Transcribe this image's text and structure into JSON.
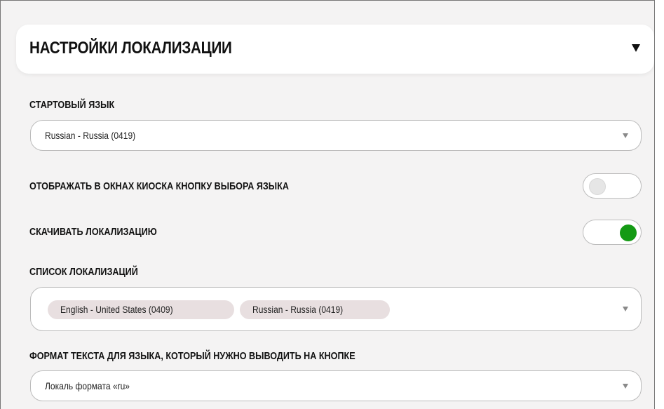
{
  "section": {
    "title": "НАСТРОЙКИ ЛОКАЛИЗАЦИИ",
    "collapse_icon": "caret-down-icon"
  },
  "start_language": {
    "label": "СТАРТОВЫЙ ЯЗЫК",
    "value": "Russian - Russia (0419)"
  },
  "show_language_button": {
    "label": "ОТОБРАЖАТЬ В ОКНАХ КИОСКА КНОПКУ ВЫБОРА ЯЗЫКА",
    "enabled": false
  },
  "download_localization": {
    "label": "СКАЧИВАТЬ ЛОКАЛИЗАЦИЮ",
    "enabled": true
  },
  "localization_list": {
    "label": "СПИСОК ЛОКАЛИЗАЦИЙ",
    "selected": [
      "English - United States (0409)",
      "Russian - Russia (0419)"
    ]
  },
  "button_text_format": {
    "label": "ФОРМАТ ТЕКСТА ДЛЯ ЯЗЫКА, КОТОРЫЙ НУЖНО ВЫВОДИТЬ НА КНОПКЕ",
    "value": "Локаль формата «ru»"
  },
  "colors": {
    "toggle_on": "#149a14",
    "chip_background": "#e8dfe0",
    "panel_background": "#f4f3f3"
  }
}
